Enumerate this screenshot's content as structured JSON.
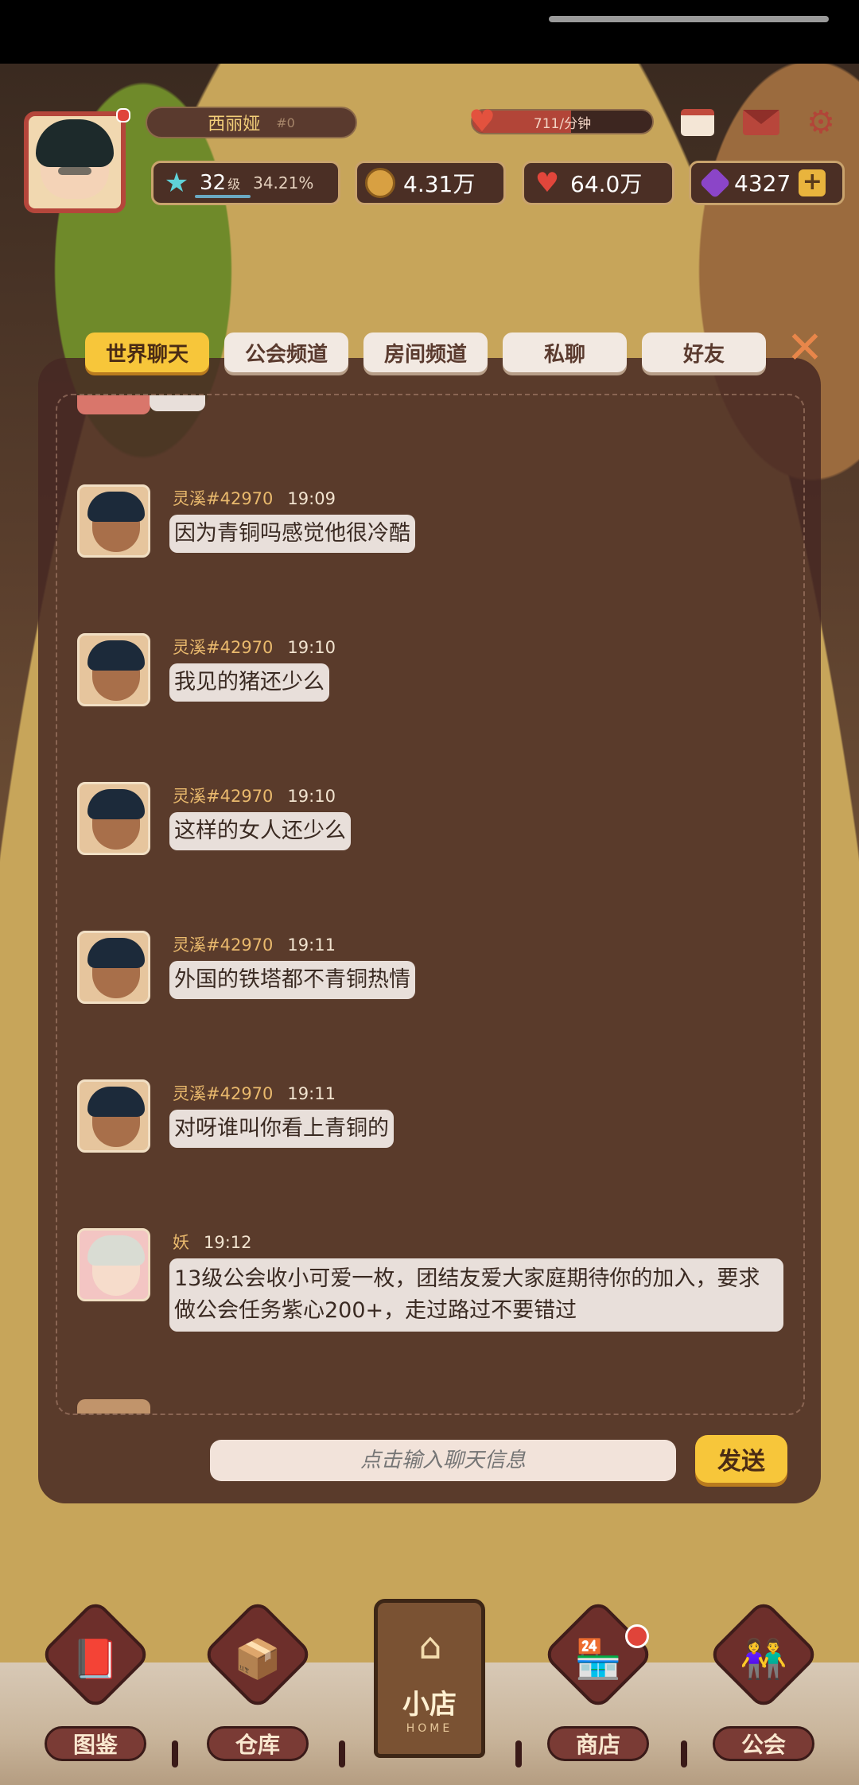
{
  "hud": {
    "player_name": "西丽娅",
    "player_tag": "#0",
    "income_rate": "711/分钟",
    "income_fill_percent": 55,
    "level_number": "32",
    "level_unit": "级",
    "level_progress": "34.21%",
    "coins": "4.31万",
    "hearts": "64.0万",
    "gems": "4327",
    "plus_symbol": "+"
  },
  "tabs": [
    {
      "label": "世界聊天",
      "active": true
    },
    {
      "label": "公会频道",
      "active": false
    },
    {
      "label": "房间频道",
      "active": false
    },
    {
      "label": "私聊",
      "active": false
    },
    {
      "label": "好友",
      "active": false
    }
  ],
  "messages": [
    {
      "user": "灵溪#42970",
      "time": "19:09",
      "text": "因为青铜吗感觉他很冷酷"
    },
    {
      "user": "灵溪#42970",
      "time": "19:10",
      "text": "我见的猪还少么"
    },
    {
      "user": "灵溪#42970",
      "time": "19:10",
      "text": "这样的女人还少么"
    },
    {
      "user": "灵溪#42970",
      "time": "19:11",
      "text": "外国的铁塔都不青铜热情"
    },
    {
      "user": "灵溪#42970",
      "time": "19:11",
      "text": "对呀谁叫你看上青铜的"
    },
    {
      "user": "妖",
      "time": "19:12",
      "text": "13级公会收小可爱一枚，团结友爱大家庭期待你的加入，要求做公会任务紫心200+，走过路过不要错过"
    }
  ],
  "input": {
    "placeholder": "点击输入聊天信息"
  },
  "send_label": "发送",
  "nav": {
    "catalog": "图鉴",
    "warehouse": "仓库",
    "shop_title": "小店",
    "shop_sub": "HOME",
    "store": "商店",
    "guild": "公会"
  },
  "icons": {
    "settings": "gear-icon",
    "calendar": "calendar-icon",
    "mail": "mail-icon",
    "close": "close-icon"
  },
  "colors": {
    "accent_yellow": "#f7c63a",
    "panel_brown": "#46282380",
    "username_gold": "#e9b96d"
  }
}
